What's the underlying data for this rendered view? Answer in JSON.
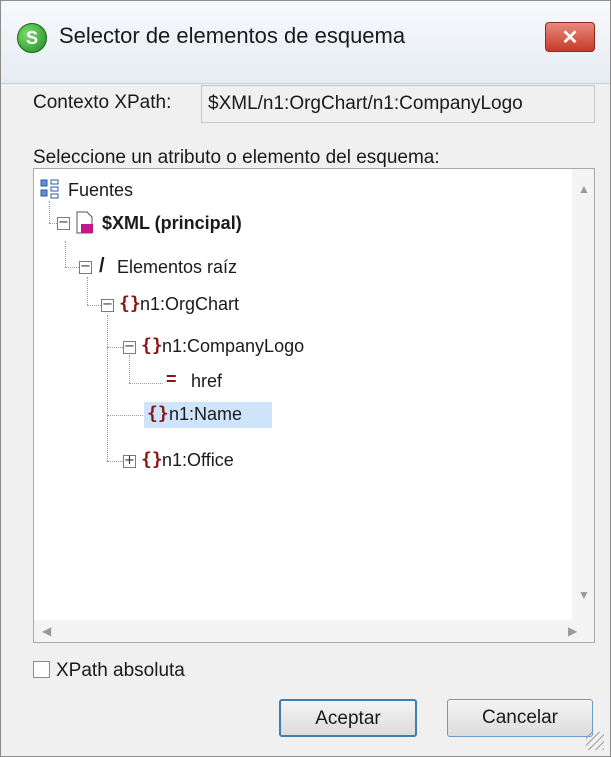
{
  "window": {
    "title": "Selector de elementos de esquema",
    "close_glyph": "✕",
    "app_icon_text": "S"
  },
  "context": {
    "label": "Contexto XPath:",
    "value": "$XML/n1:OrgChart/n1:CompanyLogo"
  },
  "tree_label": "Seleccione un atributo o elemento del esquema:",
  "tree": {
    "root": "Fuentes",
    "source": "$XML (principal)",
    "root_elements": "Elementos raíz",
    "orgchart": "n1:OrgChart",
    "companylogo": "n1:CompanyLogo",
    "href": "href",
    "name": "n1:Name",
    "office": "n1:Office",
    "selected": "n1:Name"
  },
  "icons": {
    "element": "{}",
    "attribute": "=",
    "collapse": "−",
    "expand": "+",
    "path": "/"
  },
  "absolute_checkbox": {
    "label": "XPath absoluta",
    "checked": false
  },
  "buttons": {
    "ok": "Aceptar",
    "cancel": "Cancelar"
  },
  "colors": {
    "selection": "#cde4fb",
    "element_icon": "#8b1414",
    "title_close": "#c53a28"
  }
}
